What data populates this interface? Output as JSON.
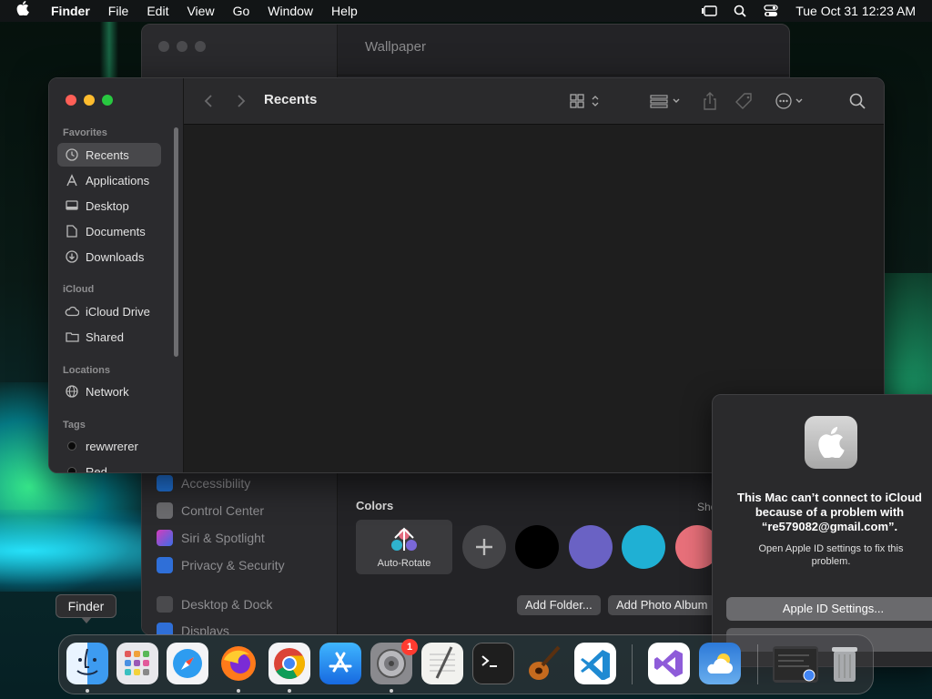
{
  "menubar": {
    "apple": "",
    "app_name": "Finder",
    "menus": [
      "File",
      "Edit",
      "View",
      "Go",
      "Window",
      "Help"
    ],
    "clock": "Tue Oct 31  12:23 AM"
  },
  "background_window": {
    "title": "Wallpaper",
    "sidebar_items": [
      "Accessibility",
      "Control Center",
      "Siri & Spotlight",
      "Privacy & Security",
      "Desktop & Dock",
      "Displays"
    ],
    "colors_label": "Colors",
    "show_label": "Sho",
    "auto_rotate_label": "Auto-Rotate",
    "add_folder": "Add Folder...",
    "add_photo_album": "Add Photo Album",
    "swatches": [
      "#000000",
      "#6a62c4",
      "#1fb0d4",
      "#e8707a"
    ]
  },
  "finder": {
    "title": "Recents",
    "sections": {
      "favorites": "Favorites",
      "icloud": "iCloud",
      "locations": "Locations",
      "tags": "Tags"
    },
    "favorites": [
      "Recents",
      "Applications",
      "Desktop",
      "Documents",
      "Downloads"
    ],
    "icloud": [
      "iCloud Drive",
      "Shared"
    ],
    "locations": [
      "Network"
    ],
    "tags": [
      "rewwrerer",
      "Red"
    ]
  },
  "dialog": {
    "message": "This Mac can’t connect to iCloud because of a problem with “re579082@gmail.com”.",
    "detail": "Open Apple ID settings to fix this problem.",
    "button": "Apple ID Settings..."
  },
  "tooltip": "Finder",
  "dock": {
    "apps": [
      "finder",
      "launchpad",
      "safari",
      "firefox",
      "chrome",
      "app-store",
      "system-settings",
      "textedit",
      "terminal",
      "garageband",
      "vscode",
      "visual-studio",
      "weather",
      "recent-window",
      "trash"
    ],
    "settings_badge": "1"
  }
}
